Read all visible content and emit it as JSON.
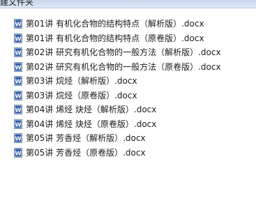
{
  "window": {
    "title": "建文件夹"
  },
  "files": [
    {
      "name": "第01讲 有机化合物的结构特点（解析版）.docx",
      "icon": "word-doc-icon"
    },
    {
      "name": "第01讲 有机化合物的结构特点（原卷版）.docx",
      "icon": "word-doc-icon"
    },
    {
      "name": "第02讲 研究有机化合物的一般方法（解析版）.docx",
      "icon": "word-doc-icon"
    },
    {
      "name": "第02讲 研究有机化合物的一般方法（原卷版）.docx",
      "icon": "word-doc-icon"
    },
    {
      "name": "第03讲 烷烃（解析版）.docx",
      "icon": "word-doc-icon"
    },
    {
      "name": "第03讲 烷烃（原卷版）.docx",
      "icon": "word-doc-icon"
    },
    {
      "name": "第04讲 烯烃 炔烃（解析版）.docx",
      "icon": "word-doc-icon"
    },
    {
      "name": "第04讲 烯烃 炔烃（原卷版）.docx",
      "icon": "word-doc-icon"
    },
    {
      "name": "第05讲 芳香烃（解析版）.docx",
      "icon": "word-doc-icon"
    },
    {
      "name": "第05讲 芳香烃（原卷版）.docx",
      "icon": "word-doc-icon"
    }
  ],
  "colors": {
    "word_icon_blue": "#2b5aa8",
    "titlebar": "#d6e3f2"
  }
}
